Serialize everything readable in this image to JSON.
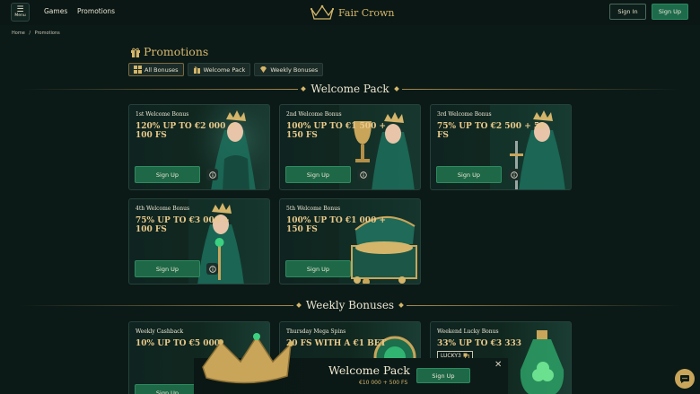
{
  "header": {
    "menu_label": "Menu",
    "nav": [
      "Games",
      "Promotions"
    ],
    "logo_text": "Fair Crown",
    "signin": "Sign In",
    "signup": "Sign Up"
  },
  "breadcrumb": [
    "Home",
    "/",
    "Promotions"
  ],
  "page_title": "Promotions",
  "filters": [
    {
      "label": "All Bonuses",
      "active": true,
      "icon": "grid-icon"
    },
    {
      "label": "Welcome Pack",
      "active": false,
      "icon": "gift-icon"
    },
    {
      "label": "Weekly Bonuses",
      "active": false,
      "icon": "diamond-icon"
    }
  ],
  "sections": {
    "welcome": "Welcome Pack",
    "weekly": "Weekly Bonuses"
  },
  "welcome_cards": [
    {
      "title": "1st Welcome Bonus",
      "offer": "120% UP TO €2 000 + 100 FS",
      "button": "Sign Up",
      "art": "queen-portrait"
    },
    {
      "title": "2nd Welcome Bonus",
      "offer": "100% UP TO €1 500 + 150 FS",
      "button": "Sign Up",
      "art": "queen-trophy"
    },
    {
      "title": "3rd Welcome Bonus",
      "offer": "75% UP TO €2 500 + 50 FS",
      "button": "Sign Up",
      "art": "queen-sword"
    },
    {
      "title": "4th Welcome Bonus",
      "offer": "75% UP TO €3 000 + 100 FS",
      "button": "Sign Up",
      "art": "queen-scepter"
    },
    {
      "title": "5th Welcome Bonus",
      "offer": "100% UP TO €1 000 + 150 FS",
      "button": "Sign Up",
      "art": "treasure-chest"
    }
  ],
  "weekly_cards": [
    {
      "title": "Weekly Cashback",
      "offer": "10% UP TO €5 000",
      "button": "Sign Up"
    },
    {
      "title": "Thursday Mega Spins",
      "offer": "20 FS WITH A €1 BET"
    },
    {
      "title": "Weekend Lucky Bonus",
      "offer": "33% UP TO €3 333",
      "code": "LUCKY3"
    }
  ],
  "popup": {
    "title": "Welcome Pack",
    "subtitle": "€10 000 + 500 FS",
    "button": "Sign Up"
  },
  "colors": {
    "background": "#0b1a17",
    "gold": "#d4b56a",
    "accent_green": "#1e6847"
  }
}
